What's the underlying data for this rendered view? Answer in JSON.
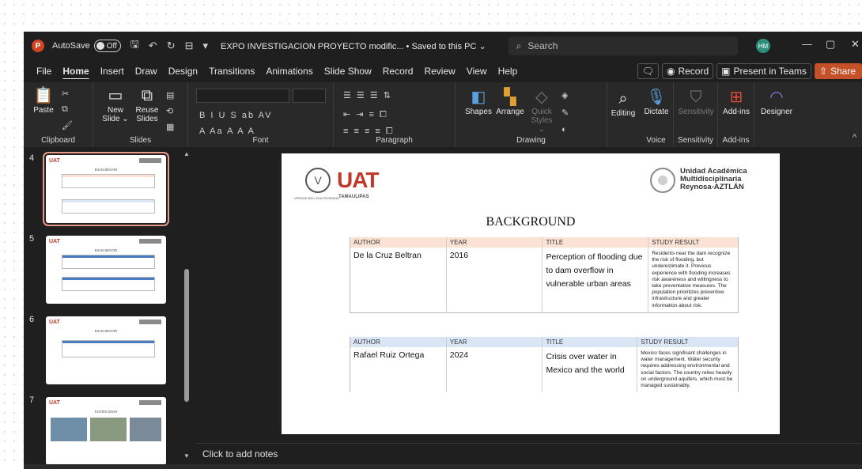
{
  "titlebar": {
    "autosave_label": "AutoSave",
    "autosave_state": "Off",
    "doc_title": "EXPO INVESTIGACION PROYECTO modific... • Saved to this PC ⌄",
    "search_placeholder": "Search",
    "avatar_initials": "HM"
  },
  "tabs": [
    "File",
    "Home",
    "Insert",
    "Draw",
    "Design",
    "Transitions",
    "Animations",
    "Slide Show",
    "Record",
    "Review",
    "View",
    "Help"
  ],
  "active_tab": "Home",
  "tabs_right": {
    "record": "Record",
    "present": "Present in Teams",
    "share": "Share"
  },
  "ribbon": {
    "clipboard": {
      "paste": "Paste",
      "label": "Clipboard"
    },
    "slides": {
      "new_slide": "New\nSlide ⌄",
      "reuse": "Reuse\nSlides",
      "label": "Slides"
    },
    "font": {
      "label": "Font",
      "row1": "B  I  U  S  ab  AV",
      "row2": "A  Aa  A  A  A"
    },
    "paragraph": {
      "label": "Paragraph"
    },
    "drawing": {
      "shapes": "Shapes",
      "arrange": "Arrange",
      "quick_styles": "Quick\nStyles ⌄",
      "label": "Drawing"
    },
    "editing": {
      "editing": "Editing"
    },
    "voice": {
      "dictate": "Dictate",
      "label": "Voice"
    },
    "sensitivity": {
      "button": "Sensitivity",
      "label": "Sensitivity"
    },
    "addins": {
      "button": "Add-ins",
      "label": "Add-ins"
    },
    "designer": {
      "button": "Designer"
    }
  },
  "thumbnails": [
    {
      "number": "4",
      "selected": true,
      "title": "BACKGROUND"
    },
    {
      "number": "5",
      "selected": false,
      "title": "BACKGROUND"
    },
    {
      "number": "6",
      "selected": false,
      "title": "BACKGROUND"
    },
    {
      "number": "7",
      "selected": false,
      "title": "JUSTIFICATION"
    }
  ],
  "slide": {
    "logo_left": "UAT",
    "logo_left_sub": "TAMAULIPAS",
    "logo_left_tagline": "VERDAD BELLEZA PROBIDAD",
    "logo_right_line1": "Unidad Académica",
    "logo_right_line2": "Multidisciplinaria",
    "logo_right_line3": "Reynosa-AZTLÁN",
    "title": "BACKGROUND",
    "table1": {
      "headers": [
        "AUTHOR",
        "YEAR",
        "TITLE",
        "STUDY RESULT"
      ],
      "row": {
        "author": "De la Cruz Beltran",
        "year": "2016",
        "title": "Perception of flooding due to dam overflow in vulnerable urban areas",
        "result": "Residents near the dam recognize the risk of flooding, but underestimate it. Previous experience with flooding increases risk awareness and willingness to take preventative measures. The population prioritizes preventive infrastructure and greater information about risk."
      }
    },
    "table2": {
      "headers": [
        "AUTHOR",
        "YEAR",
        "TITLE",
        "STUDY RESULT"
      ],
      "row": {
        "author": "Rafael Ruiz Ortega",
        "year": "2024",
        "title": "Crisis over water in Mexico and the world",
        "result": "Mexico faces significant challenges in water management. Water security requires addressing environmental and social factors. The country relies heavily on underground aquifers, which must be managed sustainably."
      }
    }
  },
  "notes_placeholder": "Click to add notes"
}
